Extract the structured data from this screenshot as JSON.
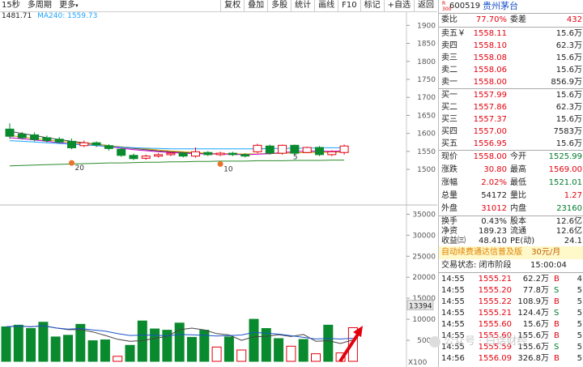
{
  "toolbar": {
    "period": "15秒",
    "multi": "多周期",
    "more": "更多",
    "buttons": [
      "复权",
      "叠加",
      "多股",
      "统计",
      "画线",
      "F10",
      "标记",
      "+自选",
      "返回"
    ]
  },
  "legend": {
    "ma_left": "1481.71",
    "ma240": "MA240: 1559.73"
  },
  "price_axis": [
    "1900",
    "1850",
    "1800",
    "1750",
    "1700",
    "1650",
    "1600",
    "1550",
    "1500"
  ],
  "volume_axis": [
    "35000",
    "30000",
    "25000",
    "20000",
    "15000",
    "10000",
    "5000"
  ],
  "volume_unit": "X100",
  "volume_marker": "13394",
  "chart_labels": {
    "a": "20",
    "b": "10",
    "c": "5"
  },
  "chart_data": [
    {
      "type": "candlestick",
      "ylim": [
        1480,
        1930
      ],
      "candles": [
        {
          "o": 1612,
          "c": 1592,
          "h": 1628,
          "l": 1585
        },
        {
          "o": 1598,
          "c": 1588,
          "h": 1604,
          "l": 1583
        },
        {
          "o": 1596,
          "c": 1583,
          "h": 1603,
          "l": 1578
        },
        {
          "o": 1588,
          "c": 1580,
          "h": 1594,
          "l": 1575
        },
        {
          "o": 1584,
          "c": 1576,
          "h": 1590,
          "l": 1572
        },
        {
          "o": 1578,
          "c": 1560,
          "h": 1586,
          "l": 1556
        },
        {
          "o": 1566,
          "c": 1574,
          "h": 1580,
          "l": 1562
        },
        {
          "o": 1574,
          "c": 1568,
          "h": 1578,
          "l": 1562
        },
        {
          "o": 1566,
          "c": 1558,
          "h": 1570,
          "l": 1552
        },
        {
          "o": 1556,
          "c": 1539,
          "h": 1560,
          "l": 1535
        },
        {
          "o": 1539,
          "c": 1530,
          "h": 1544,
          "l": 1526
        },
        {
          "o": 1531,
          "c": 1537,
          "h": 1541,
          "l": 1527
        },
        {
          "o": 1537,
          "c": 1541,
          "h": 1545,
          "l": 1533
        },
        {
          "o": 1541,
          "c": 1545,
          "h": 1549,
          "l": 1537
        },
        {
          "o": 1545,
          "c": 1537,
          "h": 1549,
          "l": 1533
        },
        {
          "o": 1537,
          "c": 1549,
          "h": 1561,
          "l": 1533
        },
        {
          "o": 1547,
          "c": 1541,
          "h": 1551,
          "l": 1537
        },
        {
          "o": 1541,
          "c": 1545,
          "h": 1549,
          "l": 1537
        },
        {
          "o": 1545,
          "c": 1541,
          "h": 1549,
          "l": 1537
        },
        {
          "o": 1541,
          "c": 1537,
          "h": 1545,
          "l": 1533
        },
        {
          "o": 1549,
          "c": 1567,
          "h": 1571,
          "l": 1545
        },
        {
          "o": 1565,
          "c": 1545,
          "h": 1569,
          "l": 1541
        },
        {
          "o": 1545,
          "c": 1567,
          "h": 1569,
          "l": 1541
        },
        {
          "o": 1567,
          "c": 1545,
          "h": 1569,
          "l": 1541
        },
        {
          "o": 1547,
          "c": 1561,
          "h": 1563,
          "l": 1545
        },
        {
          "o": 1561,
          "c": 1541,
          "h": 1565,
          "l": 1537
        },
        {
          "o": 1541,
          "c": 1549,
          "h": 1553,
          "l": 1537
        },
        {
          "o": 1547,
          "c": 1565,
          "h": 1569,
          "l": 1541
        }
      ],
      "ma_lines": [
        {
          "color": "#444444",
          "values": [
            1606,
            1600,
            1594,
            1588,
            1583,
            1578,
            1574,
            1570,
            1566,
            1562,
            1558,
            1555,
            1551,
            1549,
            1547,
            1545,
            1544,
            1543,
            1542,
            1542,
            1543,
            1544,
            1545,
            1546,
            1547,
            1548,
            1548,
            1549
          ]
        },
        {
          "color": "#d6a100",
          "values": [
            1594,
            1590,
            1586,
            1582,
            1578,
            1575,
            1572,
            1569,
            1566,
            1563,
            1560,
            1557,
            1554,
            1551,
            1549,
            1547,
            1545,
            1544,
            1543,
            1543,
            1543,
            1544,
            1545,
            1546,
            1547,
            1547,
            1548,
            1548
          ]
        },
        {
          "color": "#cc00cc",
          "values": [
            1588,
            1585,
            1582,
            1578,
            1574,
            1571,
            1569,
            1566,
            1563,
            1559,
            1555,
            1552,
            1549,
            1547,
            1545,
            1544,
            1543,
            1543,
            1542,
            1541,
            1542,
            1544,
            1547,
            1549,
            1551,
            1551,
            1550,
            1552
          ]
        },
        {
          "color": "#1aa3ff",
          "values": [
            1580,
            1578,
            1576,
            1574,
            1572,
            1570,
            1568,
            1566,
            1564,
            1562,
            1560,
            1559,
            1558,
            1557,
            1557,
            1557,
            1557,
            1557,
            1557,
            1557,
            1557,
            1558,
            1558,
            1559,
            1559,
            1560,
            1560,
            1560
          ]
        },
        {
          "color": "#2a8a2a",
          "values": [
            1510,
            1511,
            1512,
            1513,
            1514,
            1515,
            1516,
            1517,
            1518,
            1518,
            1519,
            1520,
            1520,
            1521,
            1521,
            1522,
            1522,
            1523,
            1523,
            1523,
            1524,
            1524,
            1524,
            1525,
            1525,
            1525,
            1526,
            1526
          ]
        }
      ]
    },
    {
      "type": "bar",
      "ylim": [
        0,
        37000
      ],
      "values": [
        8200,
        8600,
        7800,
        9300,
        5800,
        6200,
        8800,
        4900,
        5100,
        1200,
        3800,
        9600,
        7700,
        7400,
        9100,
        5700,
        7400,
        3400,
        5800,
        2700,
        10000,
        7800,
        5400,
        3600,
        5200,
        1800,
        8600,
        2000,
        8000
      ],
      "colors": [
        "g",
        "g",
        "g",
        "g",
        "g",
        "g",
        "g",
        "g",
        "g",
        "r",
        "g",
        "g",
        "g",
        "g",
        "g",
        "g",
        "g",
        "r",
        "g",
        "r",
        "g",
        "g",
        "g",
        "r",
        "g",
        "r",
        "g",
        "r",
        "r"
      ]
    }
  ],
  "book": {
    "badge_top": "R",
    "badge_bot": "300",
    "code": "600519",
    "name": "贵州茅台",
    "weibi_label": "委比",
    "weibi": "77.70%",
    "weicha_label": "委差",
    "weicha": "432",
    "asks": [
      {
        "label": "卖五￥",
        "price": "1558.11",
        "vol": "15.6万"
      },
      {
        "label": "卖四",
        "price": "1558.10",
        "vol": "62.3万"
      },
      {
        "label": "卖三",
        "price": "1558.08",
        "vol": "15.6万"
      },
      {
        "label": "卖二",
        "price": "1558.06",
        "vol": "15.6万"
      },
      {
        "label": "卖一",
        "price": "1558.00",
        "vol": "856.9万"
      }
    ],
    "bids": [
      {
        "label": "买一",
        "price": "1557.99",
        "vol": "15.6万"
      },
      {
        "label": "买二",
        "price": "1557.86",
        "vol": "62.3万"
      },
      {
        "label": "买三",
        "price": "1557.37",
        "vol": "15.6万"
      },
      {
        "label": "买四",
        "price": "1557.00",
        "vol": "7583万"
      },
      {
        "label": "买五",
        "price": "1556.95",
        "vol": "15.6万"
      }
    ],
    "stats": [
      {
        "l1": "现价",
        "v1": "1558.00",
        "c1": "red",
        "l2": "今开",
        "v2": "1525.99",
        "c2": "grn"
      },
      {
        "l1": "涨跌",
        "v1": "30.80",
        "c1": "red",
        "l2": "最高",
        "v2": "1569.00",
        "c2": "red"
      },
      {
        "l1": "涨幅",
        "v1": "2.02%",
        "c1": "red",
        "l2": "最低",
        "v2": "1521.01",
        "c2": "grn"
      },
      {
        "l1": "总量",
        "v1": "54172",
        "c1": "",
        "l2": "量比",
        "v2": "1.27",
        "c2": "red"
      },
      {
        "l1": "外盘",
        "v1": "31012",
        "c1": "red",
        "l2": "内盘",
        "v2": "23160",
        "c2": "grn"
      }
    ],
    "fin": [
      {
        "l1": "换手",
        "v1": "0.43%",
        "l2": "股本",
        "v2": "12.6亿"
      },
      {
        "l1": "净资",
        "v1": "189.23",
        "l2": "流通",
        "v2": "12.6亿"
      },
      {
        "l1": "收益㈢",
        "v1": "48.410",
        "l2": "PE(动)",
        "v2": "24.1"
      }
    ],
    "ad_text": "自动续费通达信普及版",
    "ad_price": "30元/月",
    "trade_status": "交易状态: 闭市阶段",
    "trade_time": "15:00:04",
    "ticks": [
      {
        "t": "14:55",
        "p": "1555.21",
        "v": "62.2万",
        "s": "B",
        "n": "4",
        "c": "red"
      },
      {
        "t": "14:55",
        "p": "1555.20",
        "v": "77.8万",
        "s": "S",
        "n": "5",
        "c": "grn"
      },
      {
        "t": "14:55",
        "p": "1555.22",
        "v": "108.9万",
        "s": "B",
        "n": "5",
        "c": "red"
      },
      {
        "t": "14:55",
        "p": "1555.21",
        "v": "124.4万",
        "s": "S",
        "n": "5",
        "c": "grn"
      },
      {
        "t": "14:55",
        "p": "1555.60",
        "v": "15.6万",
        "s": "B",
        "n": "5",
        "c": "red"
      },
      {
        "t": "14:55",
        "p": "1555.60",
        "v": "155.6万",
        "s": "B",
        "n": "5",
        "c": "red"
      },
      {
        "t": "14:55",
        "p": "1555.59",
        "v": "155.6万",
        "s": "S",
        "n": "5",
        "c": "grn"
      },
      {
        "t": "14:56",
        "p": "1556.09",
        "v": "326.8万",
        "s": "B",
        "n": "5",
        "c": "red"
      }
    ]
  },
  "watermark": "公众号 · 白话财经"
}
